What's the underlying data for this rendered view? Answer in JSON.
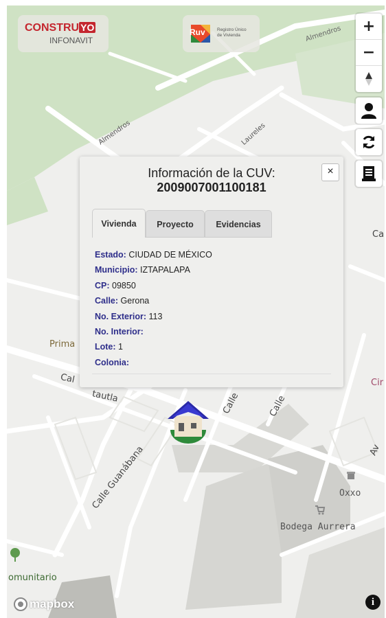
{
  "logos": {
    "construyo_part1": "CONSTRU",
    "construyo_part2": "YO",
    "construyo_sub": "INFONAVIT",
    "ruv_mark": "Ruv",
    "ruv_line1": "Registro Único",
    "ruv_line2": "de Vivienda"
  },
  "controls": {
    "zoom_in": "+",
    "zoom_out": "−",
    "compass_icon": "compass-icon",
    "profile_icon": "user-icon",
    "refresh_icon": "refresh-icon",
    "document_icon": "document-icon"
  },
  "map": {
    "streets": {
      "almendros_top": "Almendros",
      "almendros_left": "Almendros",
      "laureles": "Laureles",
      "ca_right": "Ca",
      "calle_guanabana": "Calle Guanábana",
      "calle_1": "Calle",
      "calle_2": "Calle",
      "tautla": "tautla",
      "cal_left": "Cal",
      "av_right": "Av"
    },
    "places": {
      "prima": "Prima",
      "cir": "Cir",
      "oxxo": "Oxxo",
      "bodega": "Bodega Aurrera",
      "comunitario": "omunitario"
    },
    "attribution": "mapbox",
    "info_icon": "info-icon",
    "marker_icon": "house-marker-icon"
  },
  "popup": {
    "title_line1": "Información de la CUV:",
    "title_line2": "2009007001100181",
    "close": "×",
    "tabs": [
      {
        "label": "Vivienda",
        "active": true
      },
      {
        "label": "Proyecto",
        "active": false
      },
      {
        "label": "Evidencias",
        "active": false
      }
    ],
    "fields": [
      {
        "label": "Estado:",
        "value": "CIUDAD DE MÉXICO"
      },
      {
        "label": "Municipio:",
        "value": "IZTAPALAPA"
      },
      {
        "label": "CP:",
        "value": "09850"
      },
      {
        "label": "Calle:",
        "value": "Gerona"
      },
      {
        "label": "No. Exterior:",
        "value": "113"
      },
      {
        "label": "No. Interior:",
        "value": ""
      },
      {
        "label": "Lote:",
        "value": "1"
      },
      {
        "label": "Colonia:",
        "value": ""
      }
    ]
  },
  "colors": {
    "label_color": "#2e2e8a",
    "map_bg": "#efefed",
    "park": "#cfe2c4",
    "building": "#d8d8d4",
    "road": "#ffffff",
    "marker_roof": "#2a2aa8"
  }
}
